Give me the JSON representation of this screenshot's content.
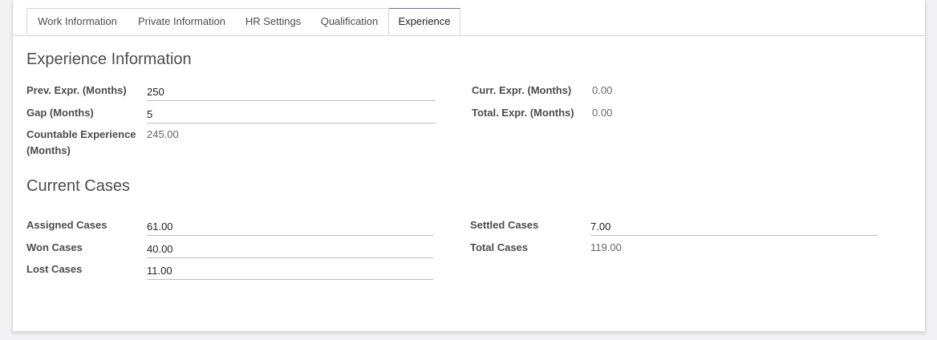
{
  "tabs": [
    {
      "label": "Work Information"
    },
    {
      "label": "Private Information"
    },
    {
      "label": "HR Settings"
    },
    {
      "label": "Qualification"
    },
    {
      "label": "Experience"
    }
  ],
  "active_tab": "Experience",
  "experience": {
    "title": "Experience Information",
    "prev_label": "Prev. Expr. (Months)",
    "prev_value": "250",
    "gap_label": "Gap (Months)",
    "gap_value": "5",
    "countable_label": "Countable Experience (Months)",
    "countable_value": "245.00",
    "curr_label": "Curr. Expr. (Months)",
    "curr_value": "0.00",
    "total_label": "Total. Expr. (Months)",
    "total_value": "0.00"
  },
  "cases": {
    "title": "Current Cases",
    "assigned_label": "Assigned Cases",
    "assigned_value": "61.00",
    "won_label": "Won Cases",
    "won_value": "40.00",
    "lost_label": "Lost Cases",
    "lost_value": "11.00",
    "settled_label": "Settled Cases",
    "settled_value": "7.00",
    "total_label": "Total Cases",
    "total_value": "119.00"
  }
}
